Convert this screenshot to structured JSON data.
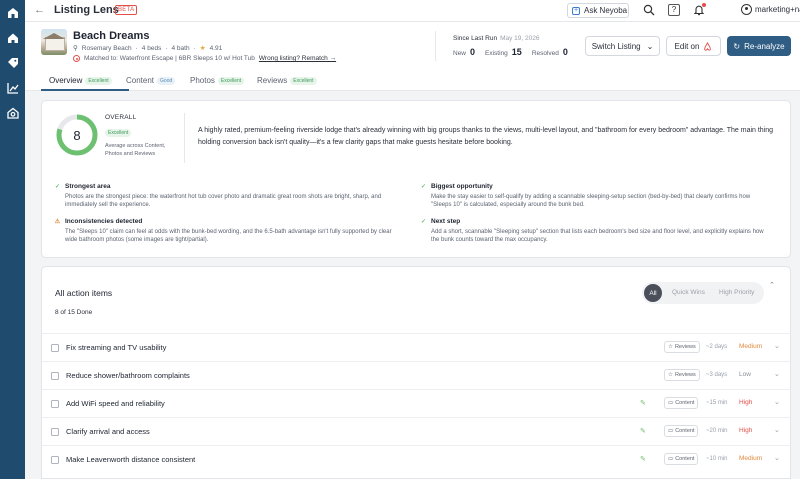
{
  "app": {
    "title": "Listing Lens",
    "beta": "BETA"
  },
  "topbar": {
    "ask_label": "Ask Neyoba",
    "account": "marketing+nasa..."
  },
  "property": {
    "name": "Beach Dreams",
    "location": "Rosemary Beach",
    "beds": "4 beds",
    "baths": "4 bath",
    "rating": "4.91",
    "matched_prefix": "Matched to: Waterfront Escape | 6BR Sleeps 10 w/ Hot Tub",
    "wrong_listing": "Wrong listing? Rematch →"
  },
  "run": {
    "since_label": "Since Last Run",
    "since_date": "May 19, 2026",
    "new_label": "New",
    "new_count": "0",
    "existing_label": "Existing",
    "existing_count": "15",
    "resolved_label": "Resolved",
    "resolved_count": "0"
  },
  "buttons": {
    "switch": "Switch Listing",
    "edit_on": "Edit on",
    "reanalyze": "Re-analyze"
  },
  "tabs": [
    {
      "label": "Overview",
      "badge": "Excellent"
    },
    {
      "label": "Content",
      "badge": "Good"
    },
    {
      "label": "Photos",
      "badge": "Excellent"
    },
    {
      "label": "Reviews",
      "badge": "Excellent"
    }
  ],
  "overall": {
    "score": "8",
    "score_fraction": 0.8,
    "label": "OVERALL",
    "badge": "Excellent",
    "sub": "Average across Content, Photos and Reviews",
    "summary": "A highly rated, premium-feeling riverside lodge that's already winning with big groups thanks to the views, multi-level layout, and \"bathroom for every bedroom\" advantage. The main thing holding conversion back isn't quality—it's a few clarity gaps that make guests hesitate before booking."
  },
  "insights": [
    {
      "title": "Strongest area",
      "icon": "check-icon",
      "body": "Photos are the strongest piece: the waterfront hot tub cover photo and dramatic great room shots are bright, sharp, and immediately sell the experience."
    },
    {
      "title": "Biggest opportunity",
      "icon": "check-icon",
      "body": "Make the stay easier to self-qualify by adding a scannable sleeping-setup section (bed-by-bed) that clearly confirms how \"Sleeps 10\" is calculated, especially around the bunk bed."
    },
    {
      "title": "Inconsistencies detected",
      "icon": "warning-icon",
      "body": "The \"Sleeps 10\" claim can feel at odds with the bunk-bed wording, and the 6.5-bath advantage isn't fully supported by clear wide bathroom photos (some images are tight/partial)."
    },
    {
      "title": "Next step",
      "icon": "check-icon",
      "body": "Add a short, scannable \"Sleeping setup\" section that lists each bedroom's bed size and floor level, and explicitly explains how the bunk counts toward the max occupancy."
    }
  ],
  "actions": {
    "title": "All action items",
    "done": "8 of 15 Done",
    "filters": [
      "All",
      "Quick Wins",
      "High Priority"
    ],
    "items": [
      {
        "title": "Fix streaming and TV usability",
        "source": "Reviews",
        "eta": "~2 days",
        "priority": "Medium",
        "prio_color": "#e08a3c",
        "edit": false
      },
      {
        "title": "Reduce shower/bathroom complaints",
        "source": "Reviews",
        "eta": "~3 days",
        "priority": "Low",
        "prio_color": "#8a909a",
        "edit": false
      },
      {
        "title": "Add WiFi speed and reliability",
        "source": "Content",
        "eta": "~15 min",
        "priority": "High",
        "prio_color": "#e0504a",
        "edit": true
      },
      {
        "title": "Clarify arrival and access",
        "source": "Content",
        "eta": "~20 min",
        "priority": "High",
        "prio_color": "#e0504a",
        "edit": true
      },
      {
        "title": "Make Leavenworth distance consistent",
        "source": "Content",
        "eta": "~10 min",
        "priority": "Medium",
        "prio_color": "#e08a3c",
        "edit": true
      }
    ]
  },
  "colors": {
    "rail": "#1f4b6e",
    "accent": "#2f5d84",
    "good": "#6cc070",
    "airbnb": "#e2504a"
  }
}
